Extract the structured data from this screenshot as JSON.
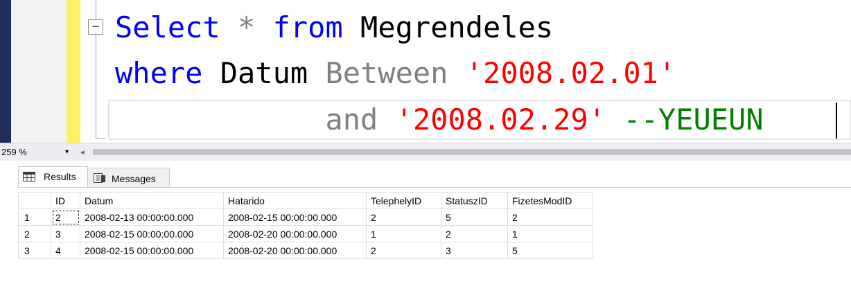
{
  "editor": {
    "lines": [
      [
        {
          "t": "Select",
          "c": "kw"
        },
        {
          "t": " ",
          "c": "plain"
        },
        {
          "t": "*",
          "c": "op"
        },
        {
          "t": " ",
          "c": "plain"
        },
        {
          "t": "from",
          "c": "kw"
        },
        {
          "t": " Megrendeles",
          "c": "plain"
        }
      ],
      [
        {
          "t": "where",
          "c": "kw"
        },
        {
          "t": " Datum ",
          "c": "plain"
        },
        {
          "t": "Between",
          "c": "op"
        },
        {
          "t": " ",
          "c": "plain"
        },
        {
          "t": "'2008.02.01'",
          "c": "str"
        }
      ],
      [
        {
          "t": "            ",
          "c": "plain"
        },
        {
          "t": "and",
          "c": "op"
        },
        {
          "t": " ",
          "c": "plain"
        },
        {
          "t": "'2008.02.29'",
          "c": "str"
        },
        {
          "t": " ",
          "c": "plain"
        },
        {
          "t": "--YEUEUN",
          "c": "cmt"
        }
      ]
    ],
    "collapse_symbol": "−"
  },
  "zoom": {
    "value": "259 %",
    "arrow": "▾",
    "scroll_left": "◂"
  },
  "tabs": {
    "results": "Results",
    "messages": "Messages"
  },
  "grid": {
    "columns": [
      "",
      "ID",
      "Datum",
      "Hatarido",
      "TelephelyID",
      "StatuszID",
      "FizetesModID"
    ],
    "rows": [
      [
        "1",
        "2",
        "2008-02-13 00:00:00.000",
        "2008-02-15 00:00:00.000",
        "2",
        "5",
        "2"
      ],
      [
        "2",
        "3",
        "2008-02-15 00:00:00.000",
        "2008-02-20 00:00:00.000",
        "1",
        "2",
        "1"
      ],
      [
        "3",
        "4",
        "2008-02-15 00:00:00.000",
        "2008-02-20 00:00:00.000",
        "2",
        "3",
        "5"
      ]
    ],
    "selected_cell": [
      0,
      1
    ]
  },
  "colors": {
    "keyword": "#0000ff",
    "operator": "#808080",
    "string": "#ff0000",
    "comment": "#008000",
    "change_bar": "#fff066",
    "left_bar": "#1e2e5e"
  }
}
